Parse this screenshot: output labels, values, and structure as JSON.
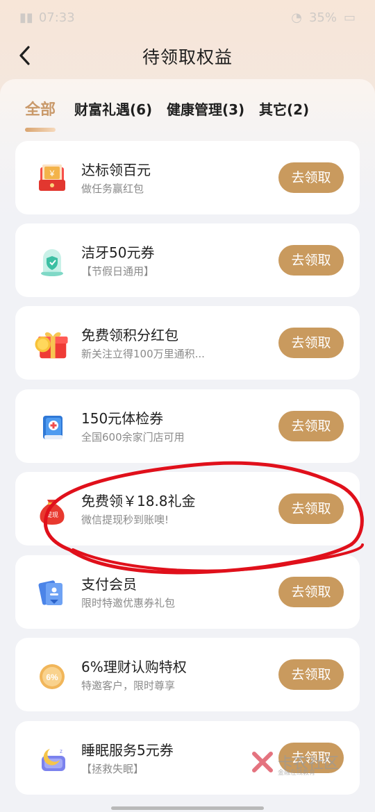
{
  "status": {
    "time": "07:33",
    "battery": "35%"
  },
  "header": {
    "title": "待领取权益"
  },
  "tabs": [
    {
      "label": "全部",
      "active": true
    },
    {
      "label": "财富礼遇(6)",
      "active": false
    },
    {
      "label": "健康管理(3)",
      "active": false
    },
    {
      "label": "其它(2)",
      "active": false
    }
  ],
  "items": [
    {
      "title": "达标领百元",
      "subtitle": "做任务赢红包",
      "button": "去领取",
      "icon": "red-envelope-icon"
    },
    {
      "title": "洁牙50元券",
      "subtitle": "【节假日通用】",
      "button": "去领取",
      "icon": "tooth-shield-icon"
    },
    {
      "title": "免费领积分红包",
      "subtitle": "新关注立得100万里通积...",
      "button": "去领取",
      "icon": "gift-box-icon"
    },
    {
      "title": "150元体检券",
      "subtitle": "全国600余家门店可用",
      "button": "去领取",
      "icon": "medical-book-icon"
    },
    {
      "title": "免费领￥18.8礼金",
      "subtitle": "微信提现秒到账噢!",
      "button": "去领取",
      "icon": "money-bag-icon",
      "bag_label": "提现"
    },
    {
      "title": "支付会员",
      "subtitle": "限时特邀优惠券礼包",
      "button": "去领取",
      "icon": "member-card-icon"
    },
    {
      "title": "6%理财认购特权",
      "subtitle": "特邀客户，限时尊享",
      "button": "去领取",
      "icon": "percent-coin-icon",
      "coin_label": "6%"
    },
    {
      "title": "睡眠服务5元券",
      "subtitle": "【拯救失眠】",
      "button": "去领取",
      "icon": "sleep-moon-icon"
    }
  ],
  "watermark": {
    "name": "卡农社区",
    "tagline": "金融在线教育"
  },
  "colors": {
    "accent": "#c99a5e",
    "tab_active": "#c9996a",
    "annotation": "#e0101b"
  }
}
